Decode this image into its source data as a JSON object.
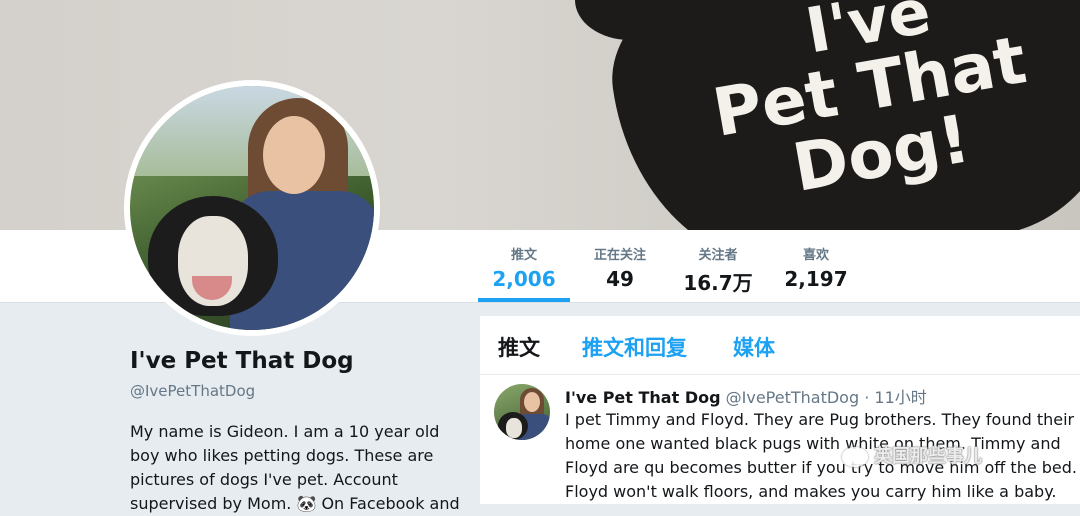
{
  "banner": {
    "text_line1": "I've",
    "text_line2": "Pet That",
    "text_line3": "Dog!"
  },
  "stats": [
    {
      "label": "推文",
      "value": "2,006",
      "active": true
    },
    {
      "label": "正在关注",
      "value": "49",
      "active": false
    },
    {
      "label": "关注者",
      "value": "16.7万",
      "active": false
    },
    {
      "label": "喜欢",
      "value": "2,197",
      "active": false
    }
  ],
  "profile": {
    "name": "I've Pet That Dog",
    "handle": "@IvePetThatDog",
    "bio": "My name is Gideon. I am a 10 year old boy who likes petting dogs. These are pictures of dogs I've pet. Account supervised by Mom. 🐼 On Facebook and"
  },
  "timeline": {
    "tabs": [
      "推文",
      "推文和回复",
      "媒体"
    ],
    "tweet": {
      "name": "I've Pet That Dog",
      "handle": "@IvePetThatDog",
      "separator": "·",
      "time": "11小时",
      "text": "I pet Timmy and Floyd. They are Pug brothers. They found their home one wanted black pugs with white on them. Timmy and Floyd are qu becomes butter if you try to move him off the bed. Floyd won't walk floors, and makes you carry him like a baby."
    }
  },
  "watermark": "英国那些事儿",
  "colors": {
    "accent": "#1da1f2",
    "text": "#14171a",
    "muted": "#657786"
  }
}
